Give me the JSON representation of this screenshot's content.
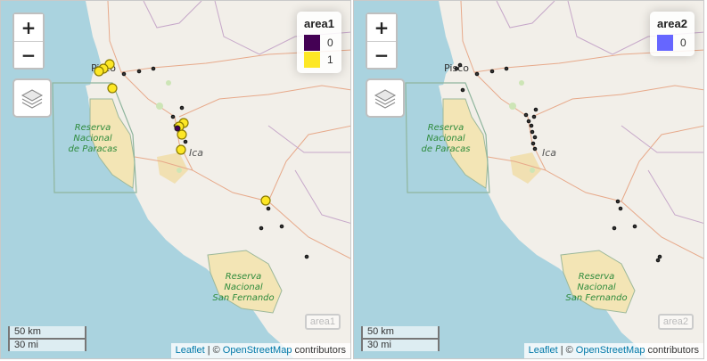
{
  "controls": {
    "zoom_in": "+",
    "zoom_out": "−"
  },
  "scale": {
    "km": "50 km",
    "mi": "30 mi"
  },
  "attribution": {
    "leaflet": "Leaflet",
    "sep": "|",
    "copy": "©",
    "osm": "OpenStreetMap",
    "contrib": "contributors"
  },
  "places": {
    "pisco": "Pisco",
    "ica": "Ica",
    "paracas": [
      "Reserva",
      "Nacional",
      "de Paracas"
    ],
    "sanfernando": [
      "Reserva",
      "Nacional",
      "San Fernando"
    ]
  },
  "colors": {
    "viridis_0": "#440154",
    "viridis_1": "#fde725",
    "area2_0": "#6666ff"
  },
  "maps": [
    {
      "legend_title": "area1",
      "legend": [
        {
          "label": "0",
          "color": "#440154"
        },
        {
          "label": "1",
          "color": "#fde725"
        }
      ],
      "badge": "area1"
    },
    {
      "legend_title": "area2",
      "legend": [
        {
          "label": "0",
          "color": "#6666ff"
        }
      ],
      "badge": "area2"
    }
  ]
}
